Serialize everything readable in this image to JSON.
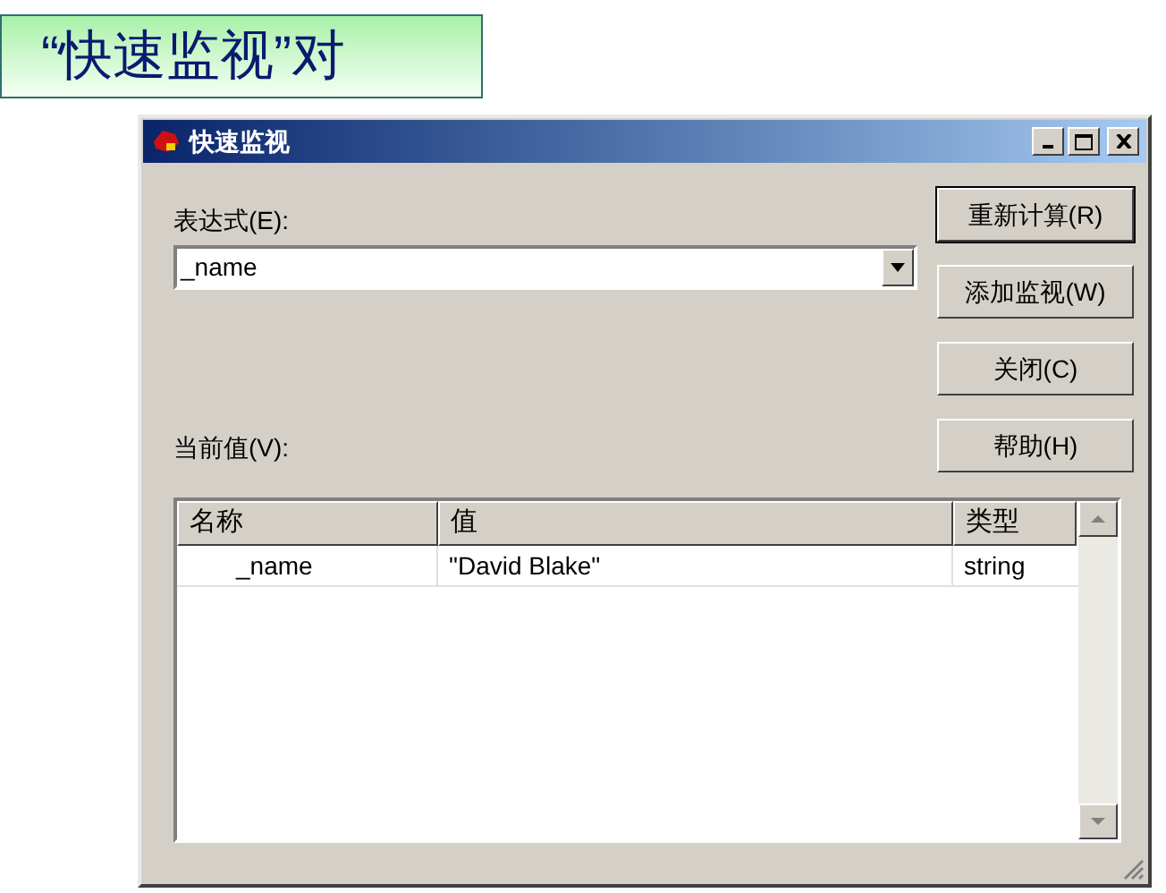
{
  "slide_title": "“快速监视”对",
  "window": {
    "title": "快速监视"
  },
  "expression": {
    "label": "表达式(E):",
    "value": "_name"
  },
  "buttons": [
    {
      "label": "重新计算(R)",
      "default": true
    },
    {
      "label": "添加监视(W)",
      "default": false
    },
    {
      "label": "关闭(C)",
      "default": false
    },
    {
      "label": "帮助(H)",
      "default": false
    }
  ],
  "current_value": {
    "label": "当前值(V):"
  },
  "table": {
    "columns": [
      "名称",
      "值",
      "类型"
    ],
    "rows": [
      {
        "name": "_name",
        "value": "\"David Blake\"",
        "type": "string"
      }
    ]
  }
}
